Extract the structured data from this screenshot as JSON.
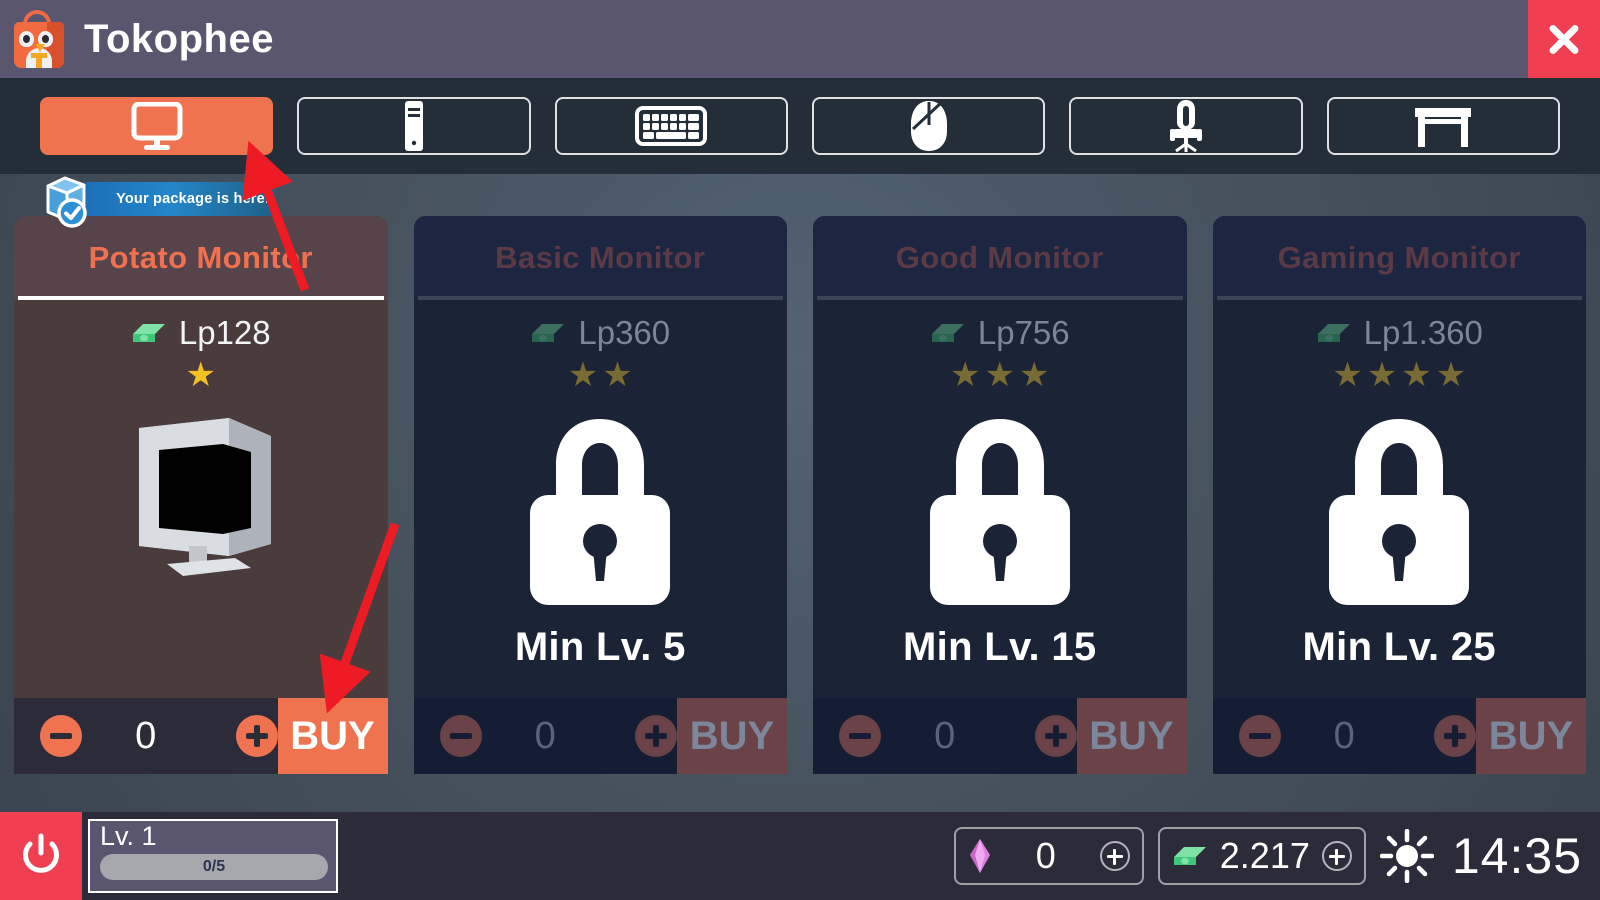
{
  "header": {
    "title": "Tokophee",
    "logo_icon": "shopping-bag-penguin-icon",
    "close_icon": "close-x-icon"
  },
  "tabs": [
    {
      "id": "monitor",
      "icon": "monitor-icon",
      "active": true
    },
    {
      "id": "pc",
      "icon": "pc-tower-icon",
      "active": false
    },
    {
      "id": "keyboard",
      "icon": "keyboard-icon",
      "active": false
    },
    {
      "id": "mouse",
      "icon": "mouse-icon",
      "active": false
    },
    {
      "id": "chair",
      "icon": "gaming-chair-icon",
      "active": false
    },
    {
      "id": "desk",
      "icon": "desk-icon",
      "active": false
    }
  ],
  "package_badge": {
    "text": "Your package is here!",
    "icon": "package-box-check-icon"
  },
  "products": [
    {
      "name": "Potato Monitor",
      "price": "Lp128",
      "stars": 1,
      "max_stars": 5,
      "locked": false,
      "quantity": "0",
      "buy_label": "BUY",
      "minus_icon": "minus-circle-icon",
      "plus_icon": "plus-circle-icon",
      "money_icon": "money-stack-icon",
      "product_icon": "crt-monitor-icon"
    },
    {
      "name": "Basic Monitor",
      "price": "Lp360",
      "stars": 2,
      "max_stars": 5,
      "locked": true,
      "lock_text": "Min Lv. 5",
      "lock_icon": "padlock-icon",
      "quantity": "0",
      "buy_label": "BUY",
      "minus_icon": "minus-circle-icon",
      "plus_icon": "plus-circle-icon",
      "money_icon": "money-stack-icon"
    },
    {
      "name": "Good Monitor",
      "price": "Lp756",
      "stars": 3,
      "max_stars": 5,
      "locked": true,
      "lock_text": "Min Lv. 15",
      "lock_icon": "padlock-icon",
      "quantity": "0",
      "buy_label": "BUY",
      "minus_icon": "minus-circle-icon",
      "plus_icon": "plus-circle-icon",
      "money_icon": "money-stack-icon"
    },
    {
      "name": "Gaming Monitor",
      "price": "Lp1.360",
      "stars": 4,
      "max_stars": 5,
      "locked": true,
      "lock_text": "Min Lv. 25",
      "lock_icon": "padlock-icon",
      "quantity": "0",
      "buy_label": "BUY",
      "minus_icon": "minus-circle-icon",
      "plus_icon": "plus-circle-icon",
      "money_icon": "money-stack-icon"
    }
  ],
  "bottom_bar": {
    "power_icon": "power-icon",
    "level_label": "Lv. 1",
    "level_progress": "0/5",
    "gem_icon": "gem-icon",
    "gem_count": "0",
    "money_icon": "money-stack-icon",
    "money_count": "2.217",
    "weather_icon": "sun-icon",
    "time": "14:35"
  },
  "annotations": [
    {
      "id": "arrow-to-monitor-tab",
      "color": "#ee1b24"
    },
    {
      "id": "arrow-to-buy-button",
      "color": "#ee1b24"
    }
  ],
  "colors": {
    "accent_orange": "#f07350",
    "header_purple": "#5a5670",
    "tabbar_dark": "#232e38",
    "close_red": "#ef3f50",
    "star_gold": "#f5c022",
    "annotation_red": "#ee1b24"
  }
}
